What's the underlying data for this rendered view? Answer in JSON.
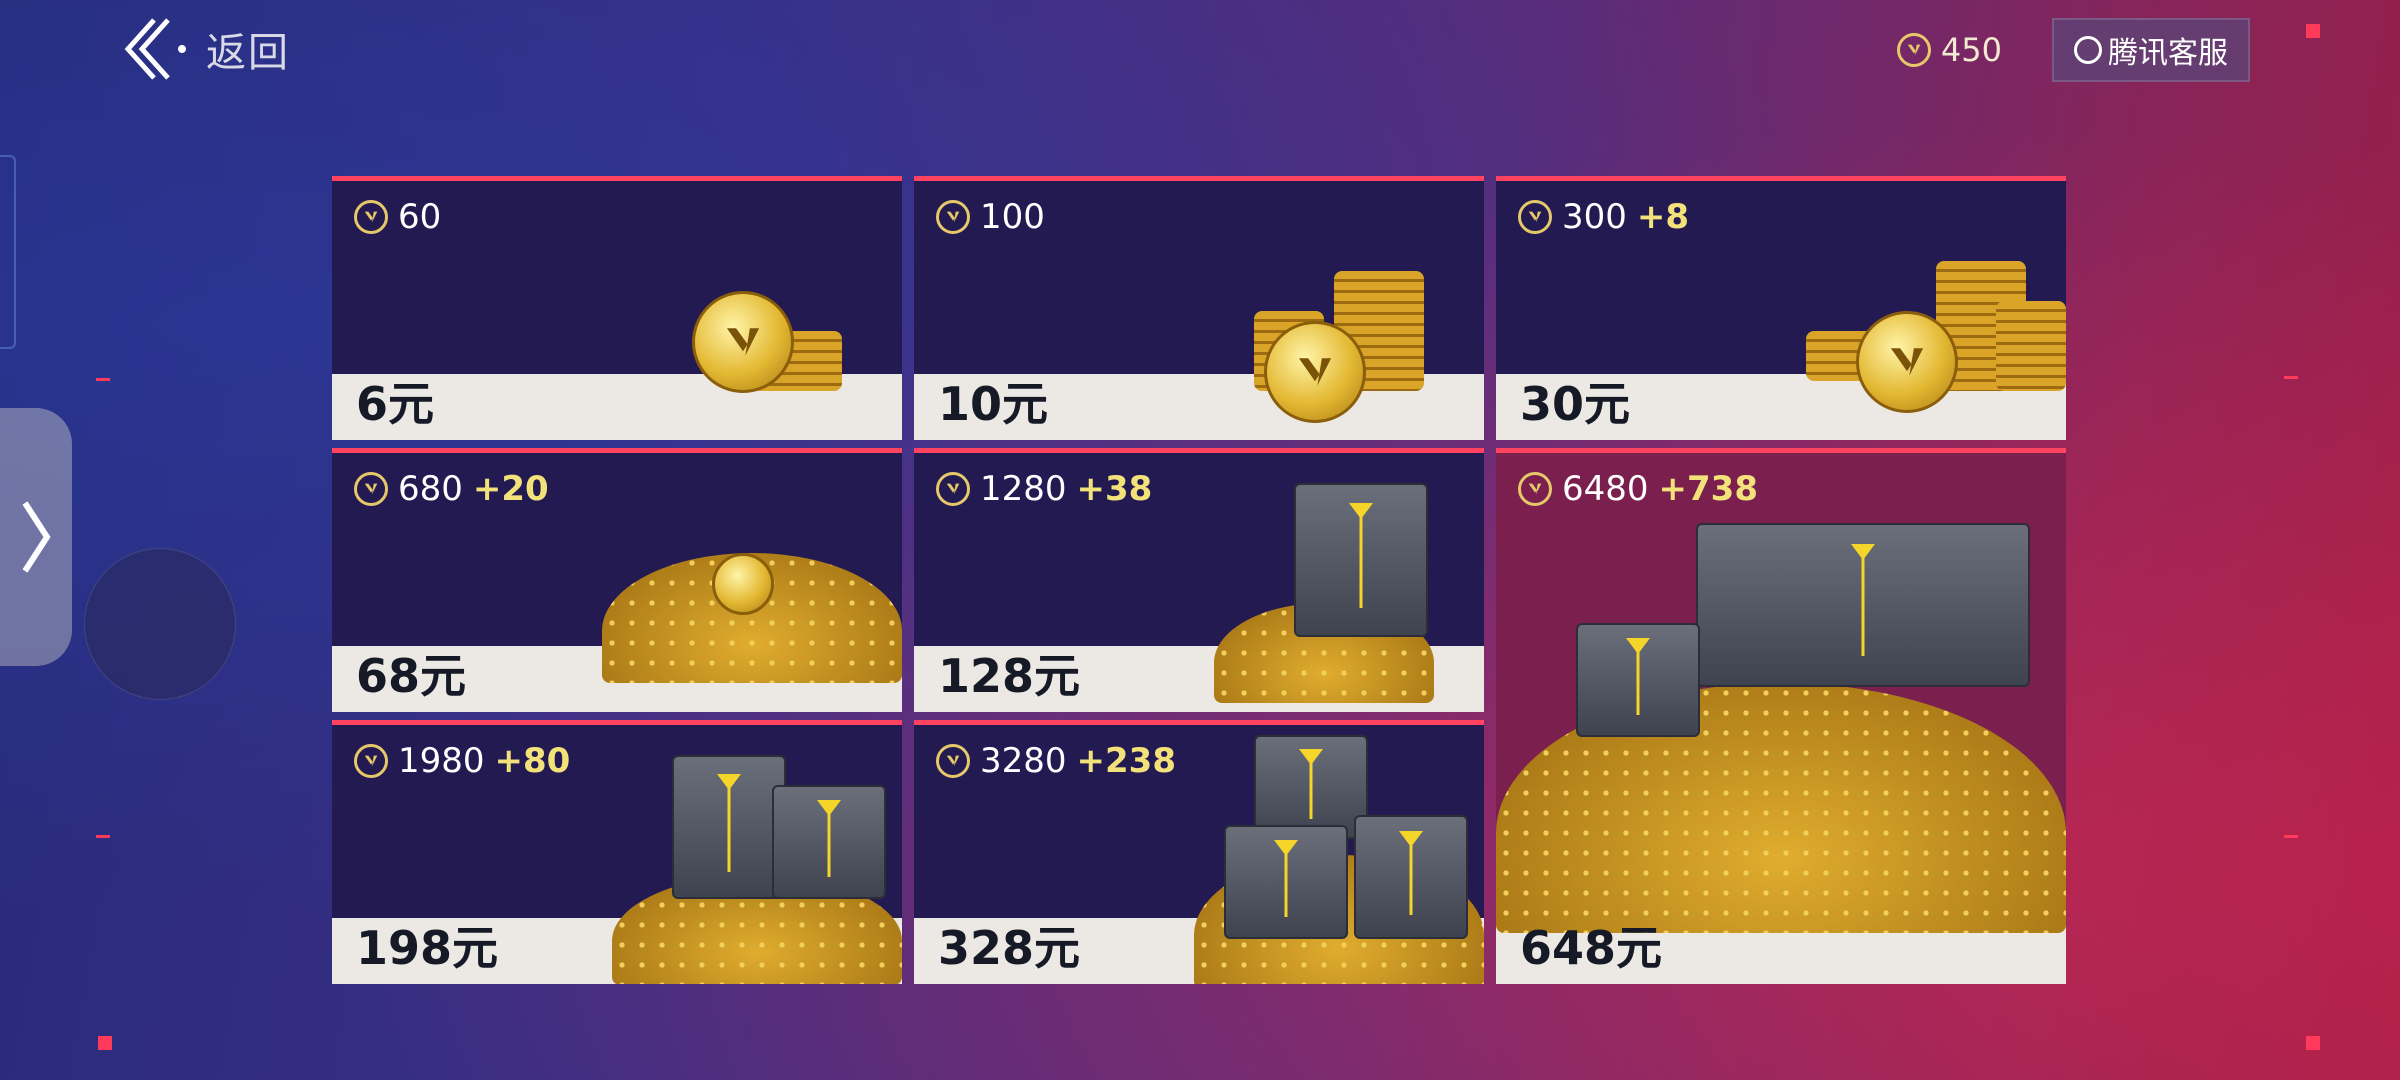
{
  "header": {
    "back_label": "返回",
    "balance": "450",
    "support_label": "腾讯客服"
  },
  "packs": [
    {
      "amount": "60",
      "bonus": "",
      "price": "6元"
    },
    {
      "amount": "100",
      "bonus": "",
      "price": "10元"
    },
    {
      "amount": "300",
      "bonus": "+8",
      "price": "30元"
    },
    {
      "amount": "680",
      "bonus": "+20",
      "price": "68元"
    },
    {
      "amount": "1280",
      "bonus": "+38",
      "price": "128元"
    },
    {
      "amount": "6480",
      "bonus": "+738",
      "price": "648元"
    },
    {
      "amount": "1980",
      "bonus": "+80",
      "price": "198元"
    },
    {
      "amount": "3280",
      "bonus": "+238",
      "price": "328元"
    }
  ],
  "colors": {
    "accent": "#ff4361",
    "bonus": "#f3e27a",
    "card_bg": "#231a52",
    "featured_bg": "#7a1f4e",
    "price_bar": "#ece8e3"
  },
  "icons": {
    "currency": "valorant-points-icon",
    "back": "chevron-left-icon",
    "support": "chat-bubble-icon",
    "side_tab": "chevron-right-icon"
  }
}
